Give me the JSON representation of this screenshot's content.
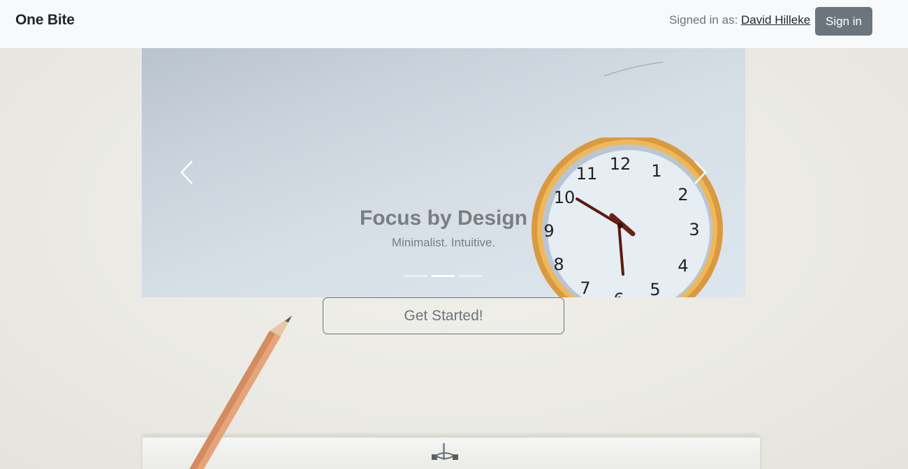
{
  "navbar": {
    "brand": "One Bite",
    "signed_in_label": "Signed in as: ",
    "user_name": "David Hilleke",
    "signin_button": "Sign in"
  },
  "carousel": {
    "title": "Focus by Design",
    "subtitle": "Minimalist. Intuitive.",
    "slide_count": 3,
    "active_slide": 2,
    "prev_icon": "chevron-left-icon",
    "next_icon": "chevron-right-icon"
  },
  "cta": {
    "label": "Get Started!"
  },
  "colors": {
    "navbar_bg": "#f8f9fa",
    "secondary": "#6c757d",
    "text_dark": "#212529"
  }
}
